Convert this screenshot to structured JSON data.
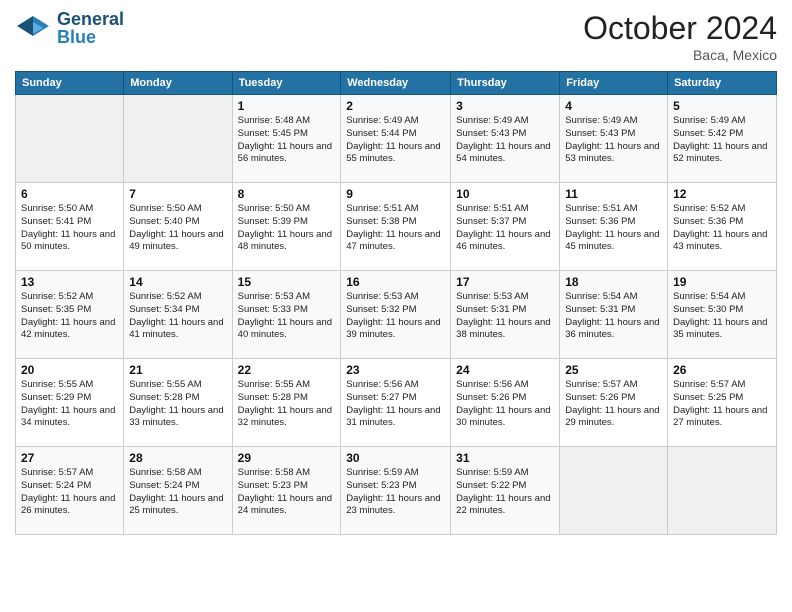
{
  "logo": {
    "name": "General",
    "name2": "Blue"
  },
  "header": {
    "month": "October 2024",
    "location": "Baca, Mexico"
  },
  "days_of_week": [
    "Sunday",
    "Monday",
    "Tuesday",
    "Wednesday",
    "Thursday",
    "Friday",
    "Saturday"
  ],
  "weeks": [
    [
      {
        "day": "",
        "detail": ""
      },
      {
        "day": "",
        "detail": ""
      },
      {
        "day": "1",
        "detail": "Sunrise: 5:48 AM\nSunset: 5:45 PM\nDaylight: 11 hours and 56 minutes."
      },
      {
        "day": "2",
        "detail": "Sunrise: 5:49 AM\nSunset: 5:44 PM\nDaylight: 11 hours and 55 minutes."
      },
      {
        "day": "3",
        "detail": "Sunrise: 5:49 AM\nSunset: 5:43 PM\nDaylight: 11 hours and 54 minutes."
      },
      {
        "day": "4",
        "detail": "Sunrise: 5:49 AM\nSunset: 5:43 PM\nDaylight: 11 hours and 53 minutes."
      },
      {
        "day": "5",
        "detail": "Sunrise: 5:49 AM\nSunset: 5:42 PM\nDaylight: 11 hours and 52 minutes."
      }
    ],
    [
      {
        "day": "6",
        "detail": "Sunrise: 5:50 AM\nSunset: 5:41 PM\nDaylight: 11 hours and 50 minutes."
      },
      {
        "day": "7",
        "detail": "Sunrise: 5:50 AM\nSunset: 5:40 PM\nDaylight: 11 hours and 49 minutes."
      },
      {
        "day": "8",
        "detail": "Sunrise: 5:50 AM\nSunset: 5:39 PM\nDaylight: 11 hours and 48 minutes."
      },
      {
        "day": "9",
        "detail": "Sunrise: 5:51 AM\nSunset: 5:38 PM\nDaylight: 11 hours and 47 minutes."
      },
      {
        "day": "10",
        "detail": "Sunrise: 5:51 AM\nSunset: 5:37 PM\nDaylight: 11 hours and 46 minutes."
      },
      {
        "day": "11",
        "detail": "Sunrise: 5:51 AM\nSunset: 5:36 PM\nDaylight: 11 hours and 45 minutes."
      },
      {
        "day": "12",
        "detail": "Sunrise: 5:52 AM\nSunset: 5:36 PM\nDaylight: 11 hours and 43 minutes."
      }
    ],
    [
      {
        "day": "13",
        "detail": "Sunrise: 5:52 AM\nSunset: 5:35 PM\nDaylight: 11 hours and 42 minutes."
      },
      {
        "day": "14",
        "detail": "Sunrise: 5:52 AM\nSunset: 5:34 PM\nDaylight: 11 hours and 41 minutes."
      },
      {
        "day": "15",
        "detail": "Sunrise: 5:53 AM\nSunset: 5:33 PM\nDaylight: 11 hours and 40 minutes."
      },
      {
        "day": "16",
        "detail": "Sunrise: 5:53 AM\nSunset: 5:32 PM\nDaylight: 11 hours and 39 minutes."
      },
      {
        "day": "17",
        "detail": "Sunrise: 5:53 AM\nSunset: 5:31 PM\nDaylight: 11 hours and 38 minutes."
      },
      {
        "day": "18",
        "detail": "Sunrise: 5:54 AM\nSunset: 5:31 PM\nDaylight: 11 hours and 36 minutes."
      },
      {
        "day": "19",
        "detail": "Sunrise: 5:54 AM\nSunset: 5:30 PM\nDaylight: 11 hours and 35 minutes."
      }
    ],
    [
      {
        "day": "20",
        "detail": "Sunrise: 5:55 AM\nSunset: 5:29 PM\nDaylight: 11 hours and 34 minutes."
      },
      {
        "day": "21",
        "detail": "Sunrise: 5:55 AM\nSunset: 5:28 PM\nDaylight: 11 hours and 33 minutes."
      },
      {
        "day": "22",
        "detail": "Sunrise: 5:55 AM\nSunset: 5:28 PM\nDaylight: 11 hours and 32 minutes."
      },
      {
        "day": "23",
        "detail": "Sunrise: 5:56 AM\nSunset: 5:27 PM\nDaylight: 11 hours and 31 minutes."
      },
      {
        "day": "24",
        "detail": "Sunrise: 5:56 AM\nSunset: 5:26 PM\nDaylight: 11 hours and 30 minutes."
      },
      {
        "day": "25",
        "detail": "Sunrise: 5:57 AM\nSunset: 5:26 PM\nDaylight: 11 hours and 29 minutes."
      },
      {
        "day": "26",
        "detail": "Sunrise: 5:57 AM\nSunset: 5:25 PM\nDaylight: 11 hours and 27 minutes."
      }
    ],
    [
      {
        "day": "27",
        "detail": "Sunrise: 5:57 AM\nSunset: 5:24 PM\nDaylight: 11 hours and 26 minutes."
      },
      {
        "day": "28",
        "detail": "Sunrise: 5:58 AM\nSunset: 5:24 PM\nDaylight: 11 hours and 25 minutes."
      },
      {
        "day": "29",
        "detail": "Sunrise: 5:58 AM\nSunset: 5:23 PM\nDaylight: 11 hours and 24 minutes."
      },
      {
        "day": "30",
        "detail": "Sunrise: 5:59 AM\nSunset: 5:23 PM\nDaylight: 11 hours and 23 minutes."
      },
      {
        "day": "31",
        "detail": "Sunrise: 5:59 AM\nSunset: 5:22 PM\nDaylight: 11 hours and 22 minutes."
      },
      {
        "day": "",
        "detail": ""
      },
      {
        "day": "",
        "detail": ""
      }
    ]
  ]
}
